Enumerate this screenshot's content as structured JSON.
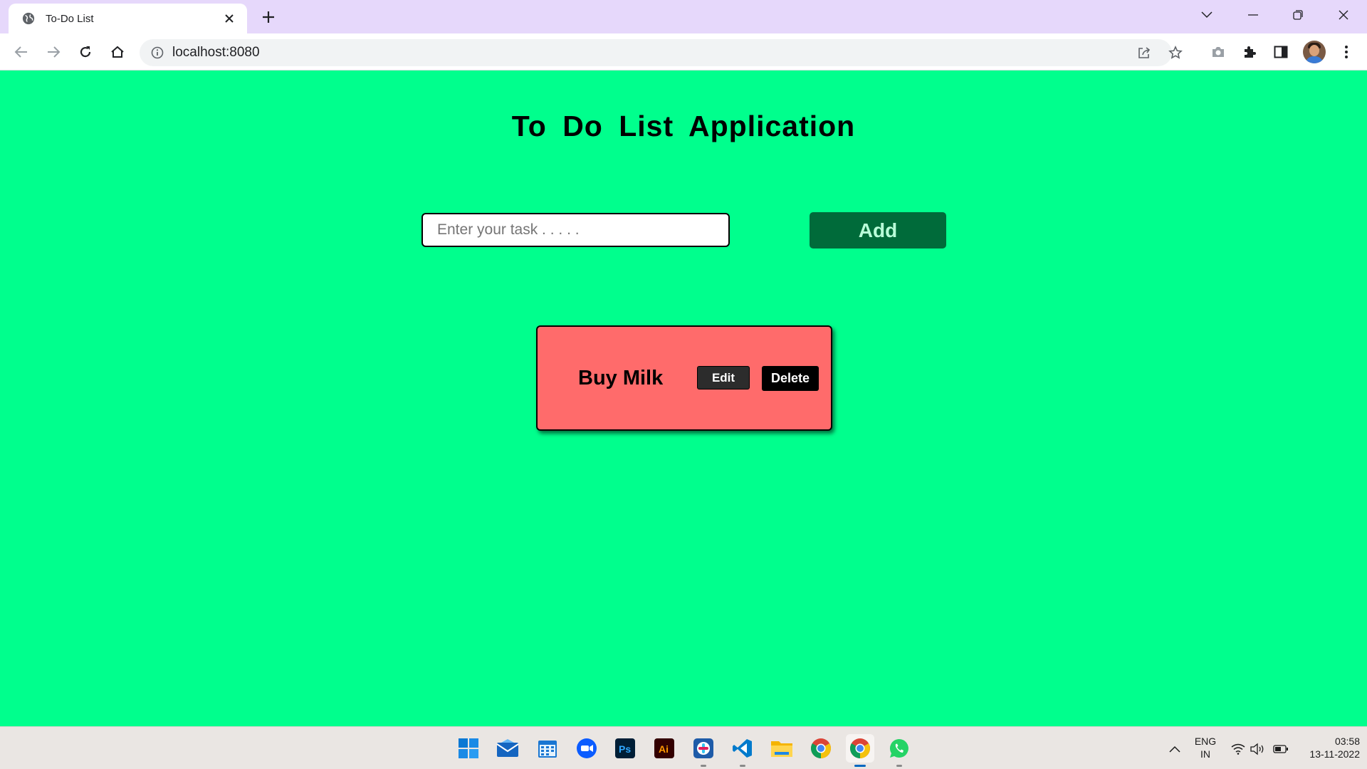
{
  "browser": {
    "tab_title": "To-Do List",
    "url": "localhost:8080"
  },
  "app": {
    "title": "To Do List Application",
    "input": {
      "placeholder": "Enter your task . . . . .",
      "value": ""
    },
    "add_label": "Add",
    "tasks": [
      {
        "text": "Buy Milk",
        "edit_label": "Edit",
        "delete_label": "Delete"
      }
    ]
  },
  "taskbar": {
    "apps": [
      "start-icon",
      "mail-icon",
      "calendar-icon",
      "zoom-icon",
      "photoshop-icon",
      "illustrator-icon",
      "slack-icon",
      "vscode-icon",
      "file-explorer-icon",
      "chrome-icon",
      "chrome-icon",
      "whatsapp-icon"
    ],
    "language_line1": "ENG",
    "language_line2": "IN",
    "time": "03:58",
    "date": "13-11-2022"
  },
  "colors": {
    "page_bg": "#00ff8d",
    "add_bg": "#006b3a",
    "task_card_bg": "#ff6b6b"
  }
}
